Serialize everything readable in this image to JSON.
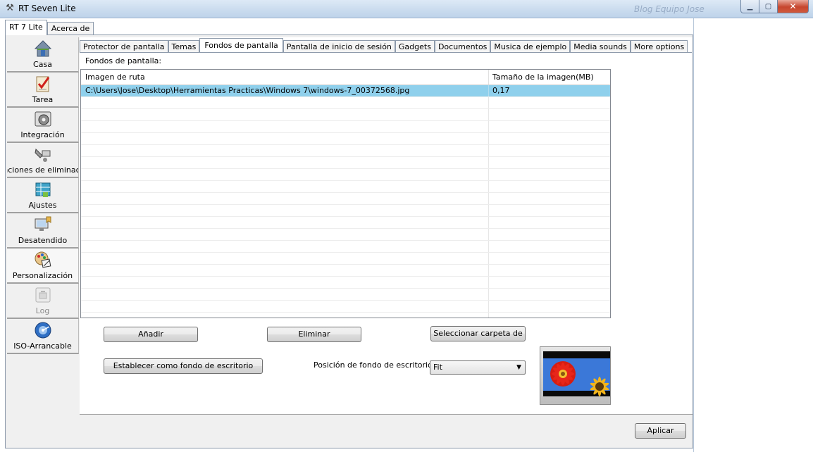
{
  "window": {
    "title": "RT Seven Lite",
    "ghost_text": "Blog Equipo Jose",
    "min_icon": "minimize-icon",
    "max_icon": "maximize-icon",
    "close_icon": "close-icon"
  },
  "top_tabs": [
    {
      "label": "RT 7 Lite",
      "active": true
    },
    {
      "label": "Acerca de",
      "active": false
    }
  ],
  "nav": [
    {
      "label": "Casa",
      "icon": "house-icon"
    },
    {
      "label": "Tarea",
      "icon": "checklist-icon"
    },
    {
      "label": "Integración",
      "icon": "integration-icon"
    },
    {
      "label": "nciones de eliminaci",
      "icon": "removal-icon"
    },
    {
      "label": "Ajustes",
      "icon": "settings-icon"
    },
    {
      "label": "Desatendido",
      "icon": "unattended-icon"
    },
    {
      "label": "Personalización",
      "icon": "palette-icon"
    },
    {
      "label": "Log",
      "icon": "log-icon"
    },
    {
      "label": "ISO-Arrancable",
      "icon": "disc-icon"
    }
  ],
  "sub_tabs": [
    {
      "label": "Protector de pantalla"
    },
    {
      "label": "Temas"
    },
    {
      "label": "Fondos de pantalla",
      "active": true
    },
    {
      "label": "Pantalla de inicio de sesión"
    },
    {
      "label": "Gadgets"
    },
    {
      "label": "Documentos"
    },
    {
      "label": "Musica de ejemplo"
    },
    {
      "label": "Media sounds"
    },
    {
      "label": "More options"
    }
  ],
  "wallpapers": {
    "section_label": "Fondos de pantalla:",
    "col_path": "Imagen de ruta",
    "col_size": "Tamaño de la imagen(MB)",
    "rows": [
      {
        "path": "C:\\Users\\Jose\\Desktop\\Herramientas Practicas\\Windows 7\\windows-7_00372568.jpg",
        "size": "0,17"
      }
    ],
    "empty_rows": 19
  },
  "buttons": {
    "add": "Añadir",
    "remove": "Eliminar",
    "select_folder": "Seleccionar carpeta de",
    "set_desktop": "Establecer como fondo de escritorio",
    "apply": "Aplicar"
  },
  "position": {
    "label": "Posición de fondo de escritorio",
    "value": "Fit"
  },
  "preview": {
    "icon": "wallpaper-preview-image"
  }
}
